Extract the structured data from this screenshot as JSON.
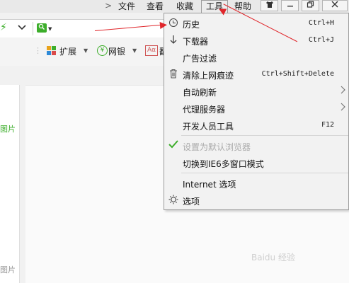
{
  "menubar": {
    "chevron": ">",
    "items": [
      "文件",
      "查看",
      "收藏",
      "工具",
      "帮助"
    ],
    "window_buttons": [
      "skin",
      "minimize",
      "maximize",
      "close"
    ]
  },
  "toolbar": {
    "extensions_label": "扩展",
    "bank_label": "网银",
    "ad_label_partial": "翻"
  },
  "left_panel": {
    "label_top": "图片",
    "label_bottom": "图片"
  },
  "tools_menu": {
    "items": [
      {
        "label": "历史",
        "shortcut": "Ctrl+H",
        "icon": "clock-icon"
      },
      {
        "label": "下载器",
        "shortcut": "Ctrl+J",
        "icon": "download-arrow-icon"
      },
      {
        "label": "广告过滤",
        "shortcut": "",
        "icon": ""
      },
      {
        "label": "清除上网痕迹",
        "shortcut": "Ctrl+Shift+Delete",
        "icon": "trash-icon"
      },
      {
        "label": "自动刷新",
        "shortcut": "",
        "icon": "",
        "submenu": true
      },
      {
        "label": "代理服务器",
        "shortcut": "",
        "icon": "",
        "submenu": true
      },
      {
        "label": "开发人员工具",
        "shortcut": "F12",
        "icon": ""
      },
      {
        "label": "设置为默认浏览器",
        "shortcut": "",
        "icon": "check-icon",
        "disabled": true
      },
      {
        "label": "切换到IE6多窗口模式",
        "shortcut": "",
        "icon": ""
      },
      {
        "label": "Internet 选项",
        "shortcut": "",
        "icon": ""
      },
      {
        "label": "选项",
        "shortcut": "",
        "icon": "gear-icon"
      }
    ]
  },
  "watermark": "Baidu 经验",
  "colors": {
    "annotation_arrow": "#e0262b",
    "brand_green": "#3dae2b"
  }
}
